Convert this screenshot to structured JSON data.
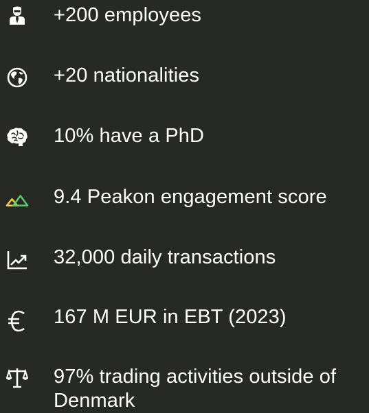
{
  "colors": {
    "background": "#272925",
    "text": "#ffffff",
    "icon": "#ffffff",
    "accent_green": "#5ed06a",
    "accent_yellow": "#f2cf3f"
  },
  "stats": [
    {
      "icon": "employee-icon",
      "text": "+200 employees"
    },
    {
      "icon": "globe-icon",
      "text": "+20 nationalities"
    },
    {
      "icon": "brain-icon",
      "text": "10% have a PhD"
    },
    {
      "icon": "peakon-logo-icon",
      "text": "9.4 Peakon engagement score"
    },
    {
      "icon": "trending-chart-icon",
      "text": "32,000 daily transactions"
    },
    {
      "icon": "euro-icon",
      "text": "167 M EUR in EBT (2023)"
    },
    {
      "icon": "scale-icon",
      "text": "97% trading activities outside of Denmark"
    }
  ]
}
